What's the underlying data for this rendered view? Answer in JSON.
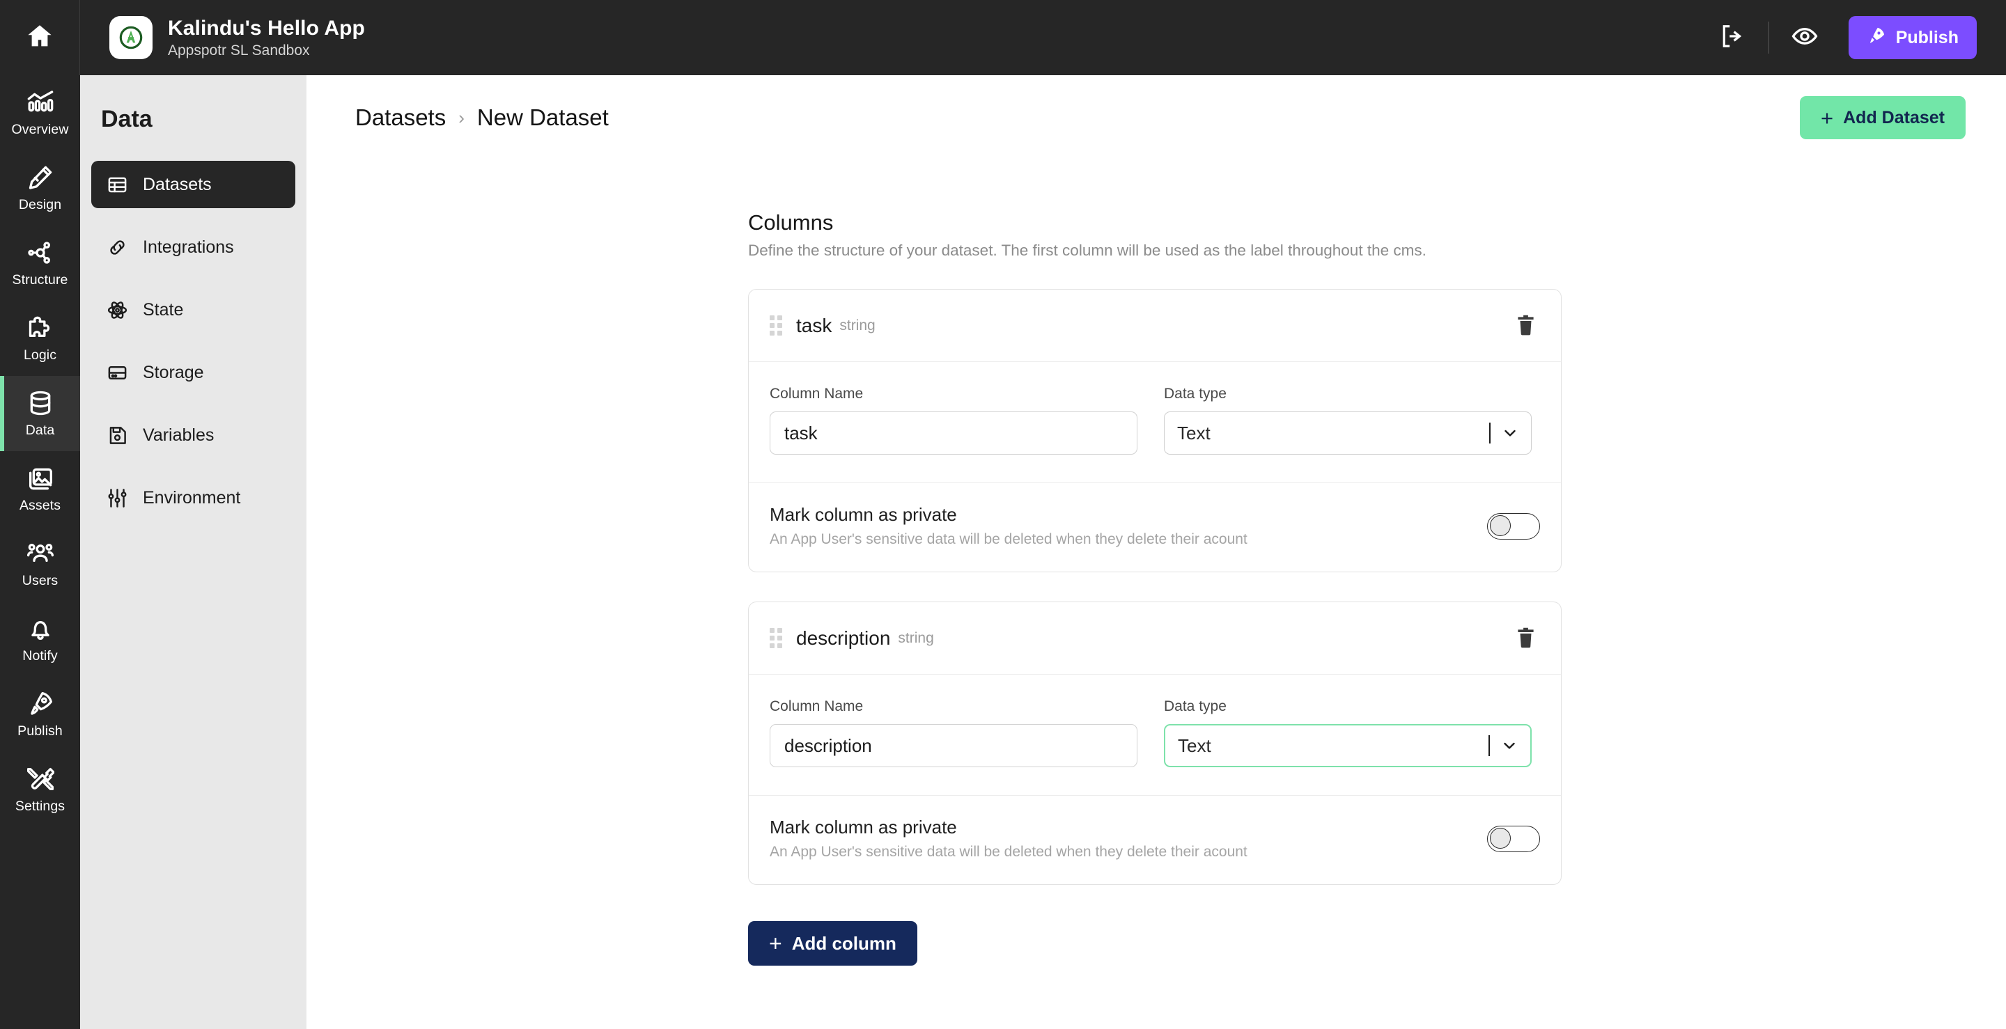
{
  "topbar": {
    "home_icon": "home-icon",
    "app_title": "Kalindu's Hello App",
    "app_subtitle": "Appspotr SL Sandbox",
    "share_icon": "share-export-icon",
    "preview_icon": "eye-preview-icon",
    "publish_label": "Publish",
    "publish_icon": "rocket-icon",
    "publish_color": "#7c4dff"
  },
  "rail": {
    "active_index": 4,
    "accent_color": "#7ee2ab",
    "items": [
      {
        "label": "Overview",
        "icon": "chart-bar-icon"
      },
      {
        "label": "Design",
        "icon": "pencil-ruler-icon"
      },
      {
        "label": "Structure",
        "icon": "nodes-network-icon"
      },
      {
        "label": "Logic",
        "icon": "puzzle-piece-icon"
      },
      {
        "label": "Data",
        "icon": "database-icon"
      },
      {
        "label": "Assets",
        "icon": "image-stack-icon"
      },
      {
        "label": "Users",
        "icon": "users-group-icon"
      },
      {
        "label": "Notify",
        "icon": "bell-icon"
      },
      {
        "label": "Publish",
        "icon": "rocket-icon"
      },
      {
        "label": "Settings",
        "icon": "tools-icon"
      }
    ]
  },
  "subnav": {
    "title": "Data",
    "active_index": 0,
    "items": [
      {
        "label": "Datasets",
        "icon": "table-grid-icon"
      },
      {
        "label": "Integrations",
        "icon": "link-chain-icon"
      },
      {
        "label": "State",
        "icon": "atom-icon"
      },
      {
        "label": "Storage",
        "icon": "storage-drive-icon"
      },
      {
        "label": "Variables",
        "icon": "floppy-disk-icon"
      },
      {
        "label": "Environment",
        "icon": "sliders-icon"
      }
    ]
  },
  "page": {
    "breadcrumb": [
      "Datasets",
      "New Dataset"
    ],
    "breadcrumb_separator": "›",
    "add_dataset_label": "Add Dataset",
    "add_dataset_plus": "+",
    "add_dataset_color": "#72e6a8"
  },
  "columns_section": {
    "title": "Columns",
    "description": "Define the structure of your dataset. The first column will be used as the label throughout the cms.",
    "field_labels": {
      "column_name": "Column Name",
      "data_type": "Data type"
    },
    "private": {
      "title": "Mark column as private",
      "description": "An App User's sensitive data will be deleted when they delete their acount",
      "toggle_state": "off"
    },
    "delete_icon": "trash-icon",
    "drag_icon": "drag-handle-icon",
    "columns": [
      {
        "name": "task",
        "type_tag": "string",
        "column_name_value": "task",
        "data_type_value": "Text",
        "data_type_focused": false,
        "private_enabled": false
      },
      {
        "name": "description",
        "type_tag": "string",
        "column_name_value": "description",
        "data_type_value": "Text",
        "data_type_focused": true,
        "private_enabled": false
      }
    ],
    "add_column_label": "Add column",
    "add_column_plus": "+",
    "add_column_color": "#15295c"
  }
}
